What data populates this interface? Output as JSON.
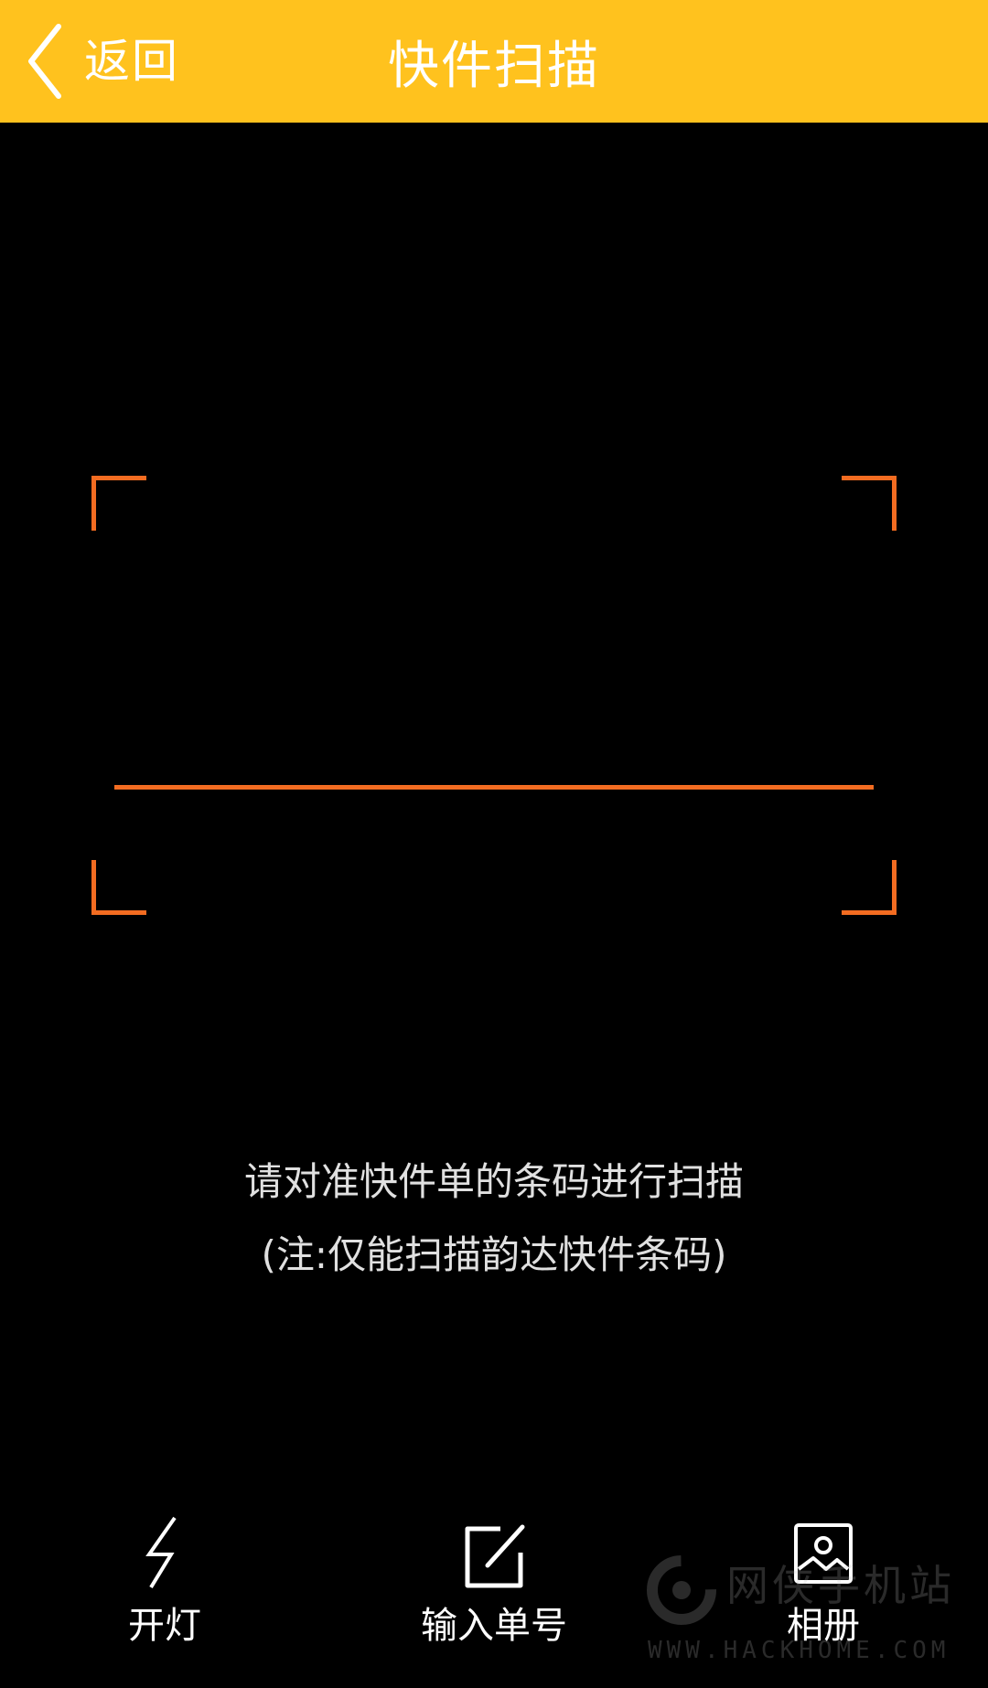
{
  "topbar": {
    "back_label": "返回",
    "title": "快件扫描",
    "background": "#FFC21E"
  },
  "scanner": {
    "frame_color": "#F36C21"
  },
  "hint": {
    "line1": "请对准快件单的条码进行扫描",
    "line2": "(注:仅能扫描韵达快件条码)"
  },
  "toolbar": {
    "items": [
      {
        "label": "开灯",
        "icon": "flash-icon"
      },
      {
        "label": "输入单号",
        "icon": "edit-icon"
      },
      {
        "label": "相册",
        "icon": "album-icon"
      }
    ]
  },
  "watermark": {
    "text": "网侠手机站",
    "url": "WWW.HACKHOME.COM"
  }
}
